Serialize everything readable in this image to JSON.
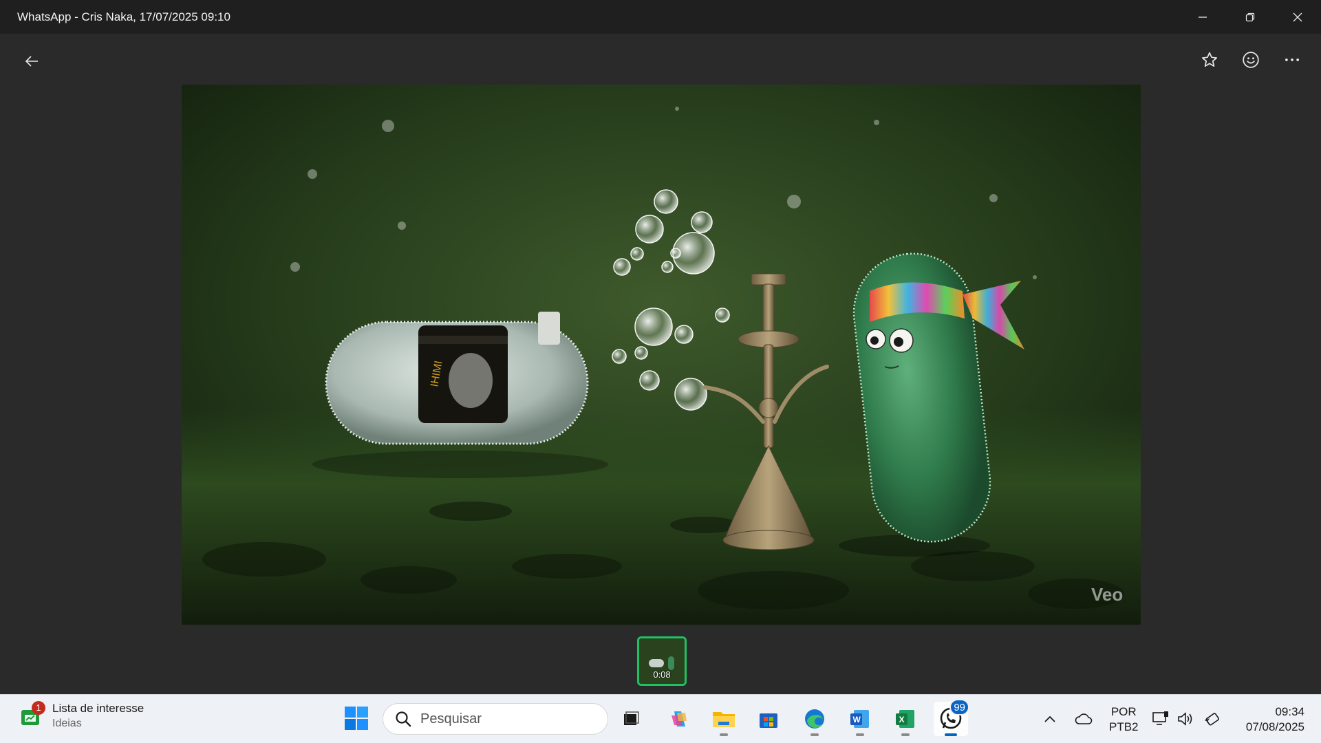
{
  "window": {
    "title": "WhatsApp - Cris Naka, 17/07/2025 09:10"
  },
  "viewer": {
    "back_icon": "arrow-left-icon",
    "actions": [
      {
        "name": "star-icon"
      },
      {
        "name": "emoji-react-icon"
      },
      {
        "name": "more-options-icon"
      }
    ],
    "watermark": "Veo",
    "thumbnail": {
      "duration": "0:08"
    }
  },
  "taskbar": {
    "widget": {
      "title": "Lista de interesse",
      "subtitle": "Ideias",
      "notification_count": "1"
    },
    "search": {
      "placeholder": "Pesquisar"
    },
    "apps": [
      {
        "name": "task-view-icon"
      },
      {
        "name": "copilot-icon"
      },
      {
        "name": "file-explorer-icon"
      },
      {
        "name": "microsoft-store-icon"
      },
      {
        "name": "edge-icon"
      },
      {
        "name": "word-icon"
      },
      {
        "name": "excel-icon"
      },
      {
        "name": "whatsapp-icon",
        "badge": "99"
      }
    ],
    "tray": {
      "language": "POR",
      "layout": "PTB2",
      "time": "09:34",
      "date": "07/08/2025"
    }
  },
  "colors": {
    "accent_green": "#21c063",
    "taskbar_badge": "#0a64c4"
  }
}
